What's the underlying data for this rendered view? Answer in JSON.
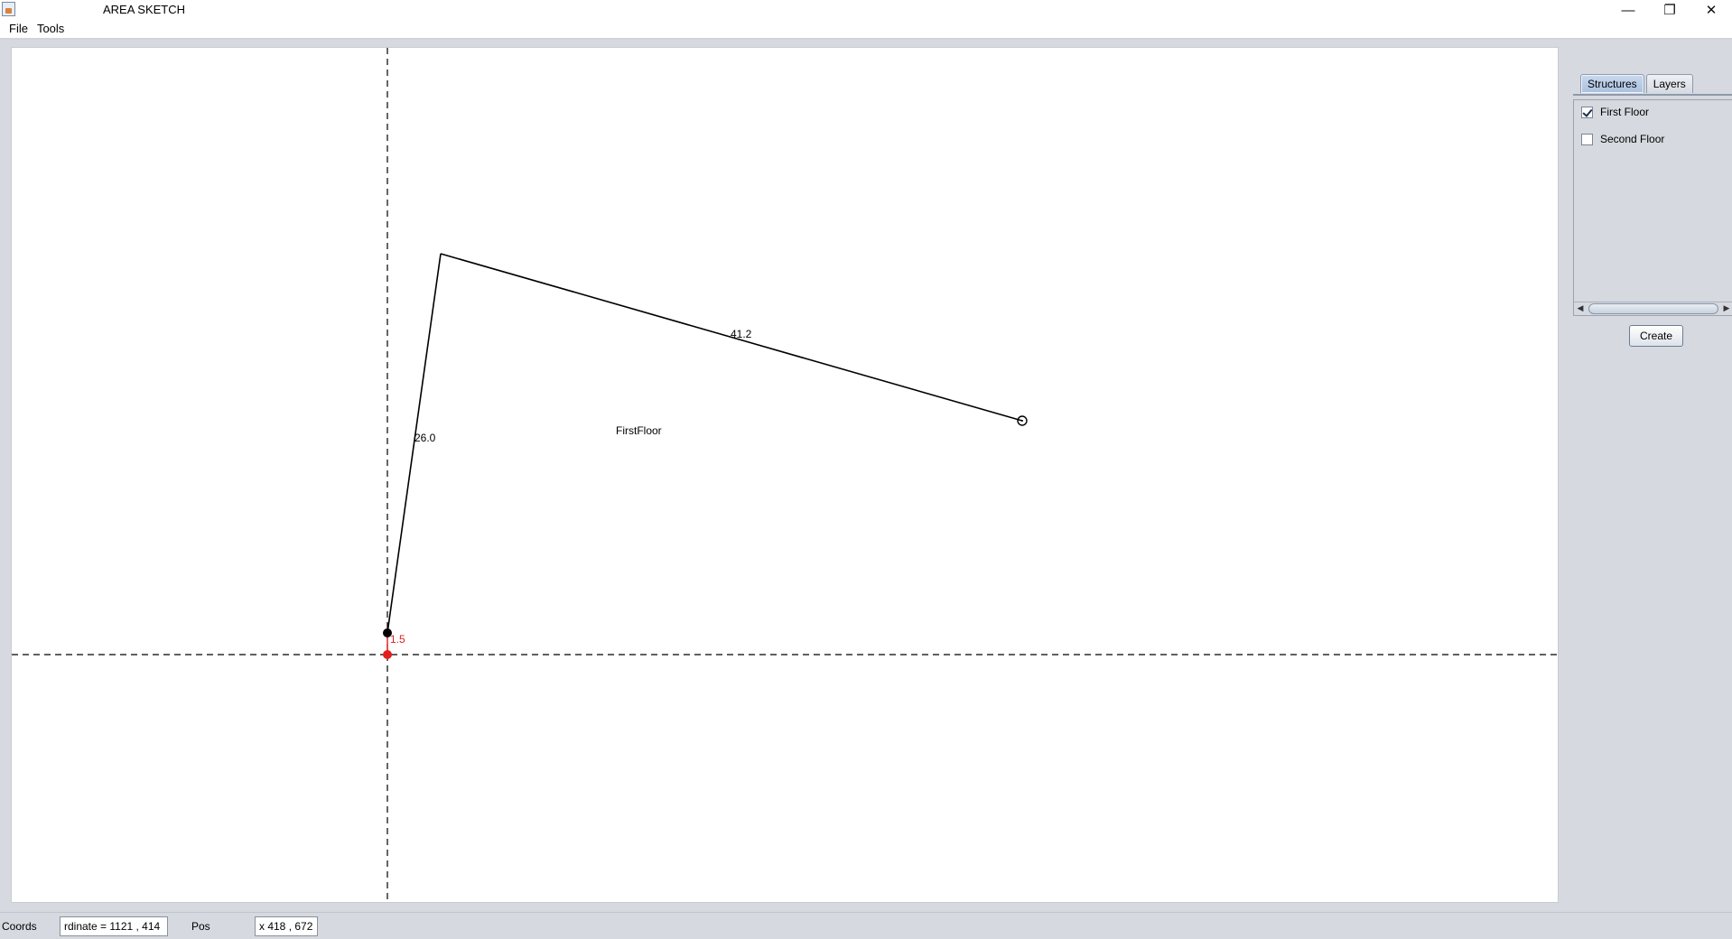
{
  "window": {
    "title": "AREA SKETCH",
    "minimize_glyph": "—",
    "maximize_glyph": "❐",
    "close_glyph": "✕"
  },
  "menu": {
    "items": [
      {
        "label": "File"
      },
      {
        "label": "Tools"
      }
    ]
  },
  "canvas": {
    "structure_label": "FirstFloor",
    "segments": [
      {
        "length_label": "26.0"
      },
      {
        "length_label": "41.2"
      },
      {
        "length_label": "1.5"
      }
    ],
    "colors": {
      "line": "#000000",
      "guide": "#000000",
      "origin_point": "#e41e1e",
      "active_label": "#e41e1e"
    }
  },
  "side_panel": {
    "tabs": [
      {
        "label": "Structures",
        "active": true
      },
      {
        "label": "Layers",
        "active": false
      }
    ],
    "structures": [
      {
        "label": "First Floor",
        "checked": true
      },
      {
        "label": "Second Floor",
        "checked": false
      }
    ],
    "create_label": "Create"
  },
  "status": {
    "coords_label": "Coords",
    "coords_value": "rdinate = 1121 , 414",
    "pos_label": "Pos",
    "pos_value": "x 418 , 672"
  }
}
